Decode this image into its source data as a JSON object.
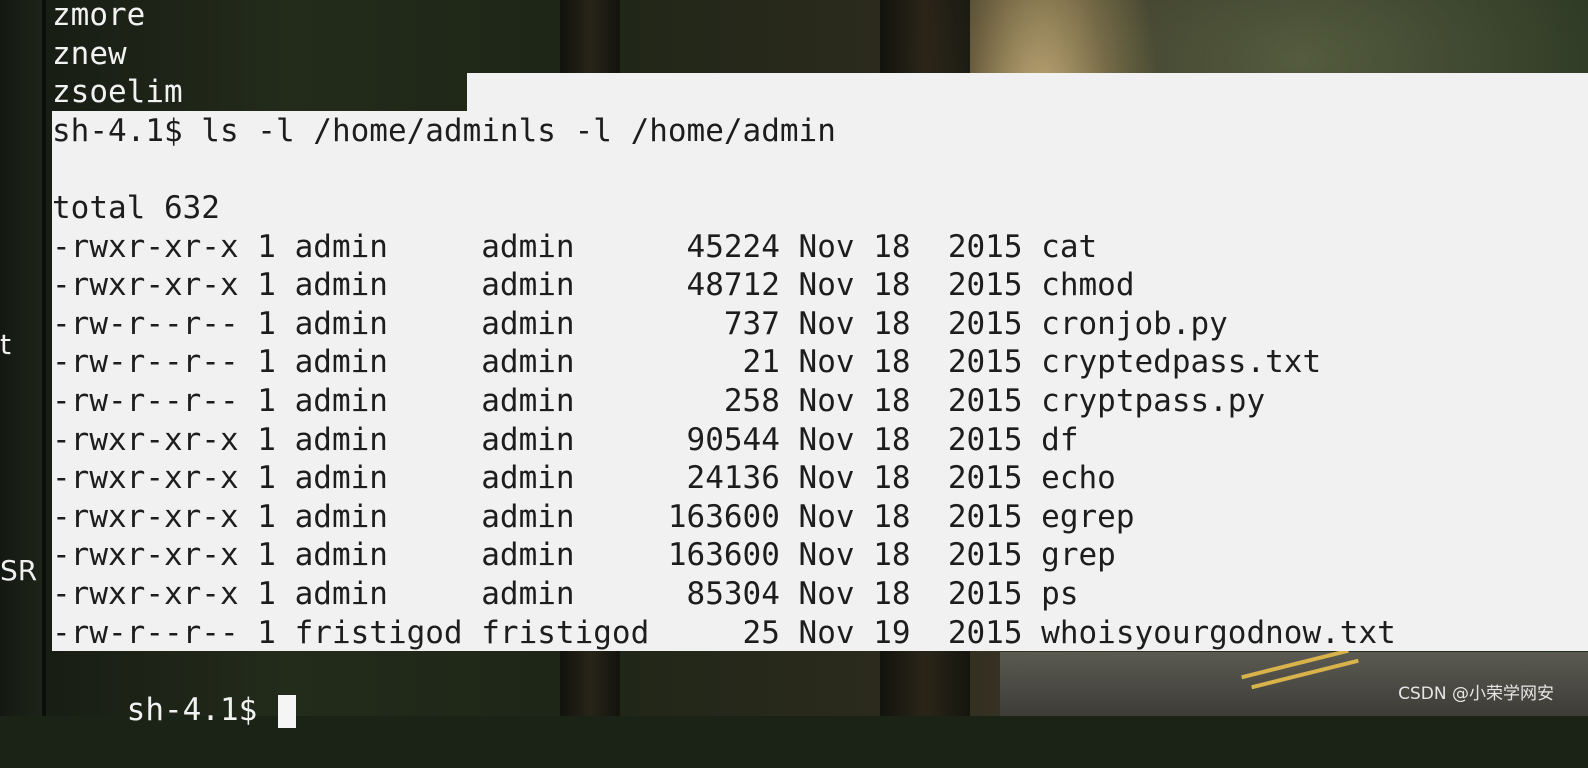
{
  "sidebar": {
    "labels": [
      "t",
      "SR"
    ]
  },
  "terminal": {
    "pre_lines": [
      "zmore",
      "znew",
      "zsoelim"
    ],
    "command_line": "sh-4.1$ ls -l /home/adminls -l /home/admin",
    "blank_line": "",
    "total_line": "total 632",
    "listing": [
      "-rwxr-xr-x 1 admin     admin      45224 Nov 18  2015 cat",
      "-rwxr-xr-x 1 admin     admin      48712 Nov 18  2015 chmod",
      "-rw-r--r-- 1 admin     admin        737 Nov 18  2015 cronjob.py",
      "-rw-r--r-- 1 admin     admin         21 Nov 18  2015 cryptedpass.txt",
      "-rw-r--r-- 1 admin     admin        258 Nov 18  2015 cryptpass.py",
      "-rwxr-xr-x 1 admin     admin      90544 Nov 18  2015 df",
      "-rwxr-xr-x 1 admin     admin      24136 Nov 18  2015 echo",
      "-rwxr-xr-x 1 admin     admin     163600 Nov 18  2015 egrep",
      "-rwxr-xr-x 1 admin     admin     163600 Nov 18  2015 grep",
      "-rwxr-xr-x 1 admin     admin      85304 Nov 18  2015 ps",
      "-rw-r--r-- 1 fristigod fristigod     25 Nov 19  2015 whoisyourgodnow.txt"
    ],
    "prompt": "sh-4.1$ "
  },
  "watermark": "CSDN @小荣学网安"
}
